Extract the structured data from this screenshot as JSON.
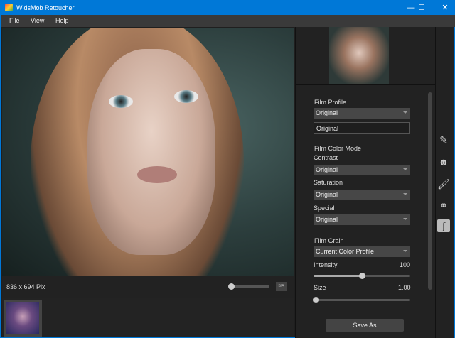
{
  "window": {
    "title": "WidsMob Retoucher",
    "minimize": "—",
    "maximize": "☐",
    "close": "✕"
  },
  "menu": [
    "File",
    "View",
    "Help"
  ],
  "image": {
    "dimensions": "836 x 694 Pix",
    "compare_label": "B/A",
    "zoom_fraction": 0.0
  },
  "panel": {
    "film_profile": {
      "label": "Film Profile",
      "value": "Original",
      "name_value": "Original"
    },
    "film_color_mode": {
      "label": "Film Color Mode",
      "contrast": {
        "label": "Contrast",
        "value": "Original"
      },
      "saturation": {
        "label": "Saturation",
        "value": "Original"
      },
      "special": {
        "label": "Special",
        "value": "Original"
      }
    },
    "film_grain": {
      "label": "Film Grain",
      "value": "Current Color Profile",
      "intensity": {
        "label": "Intensity",
        "value": "100",
        "fraction": 0.5
      },
      "size": {
        "label": "Size",
        "value": "1.00",
        "fraction": 0.0
      }
    },
    "save_label": "Save As"
  },
  "tools": [
    "pencil-icon",
    "face-icon",
    "brush-icon",
    "color-circles-icon",
    "film-icon"
  ]
}
